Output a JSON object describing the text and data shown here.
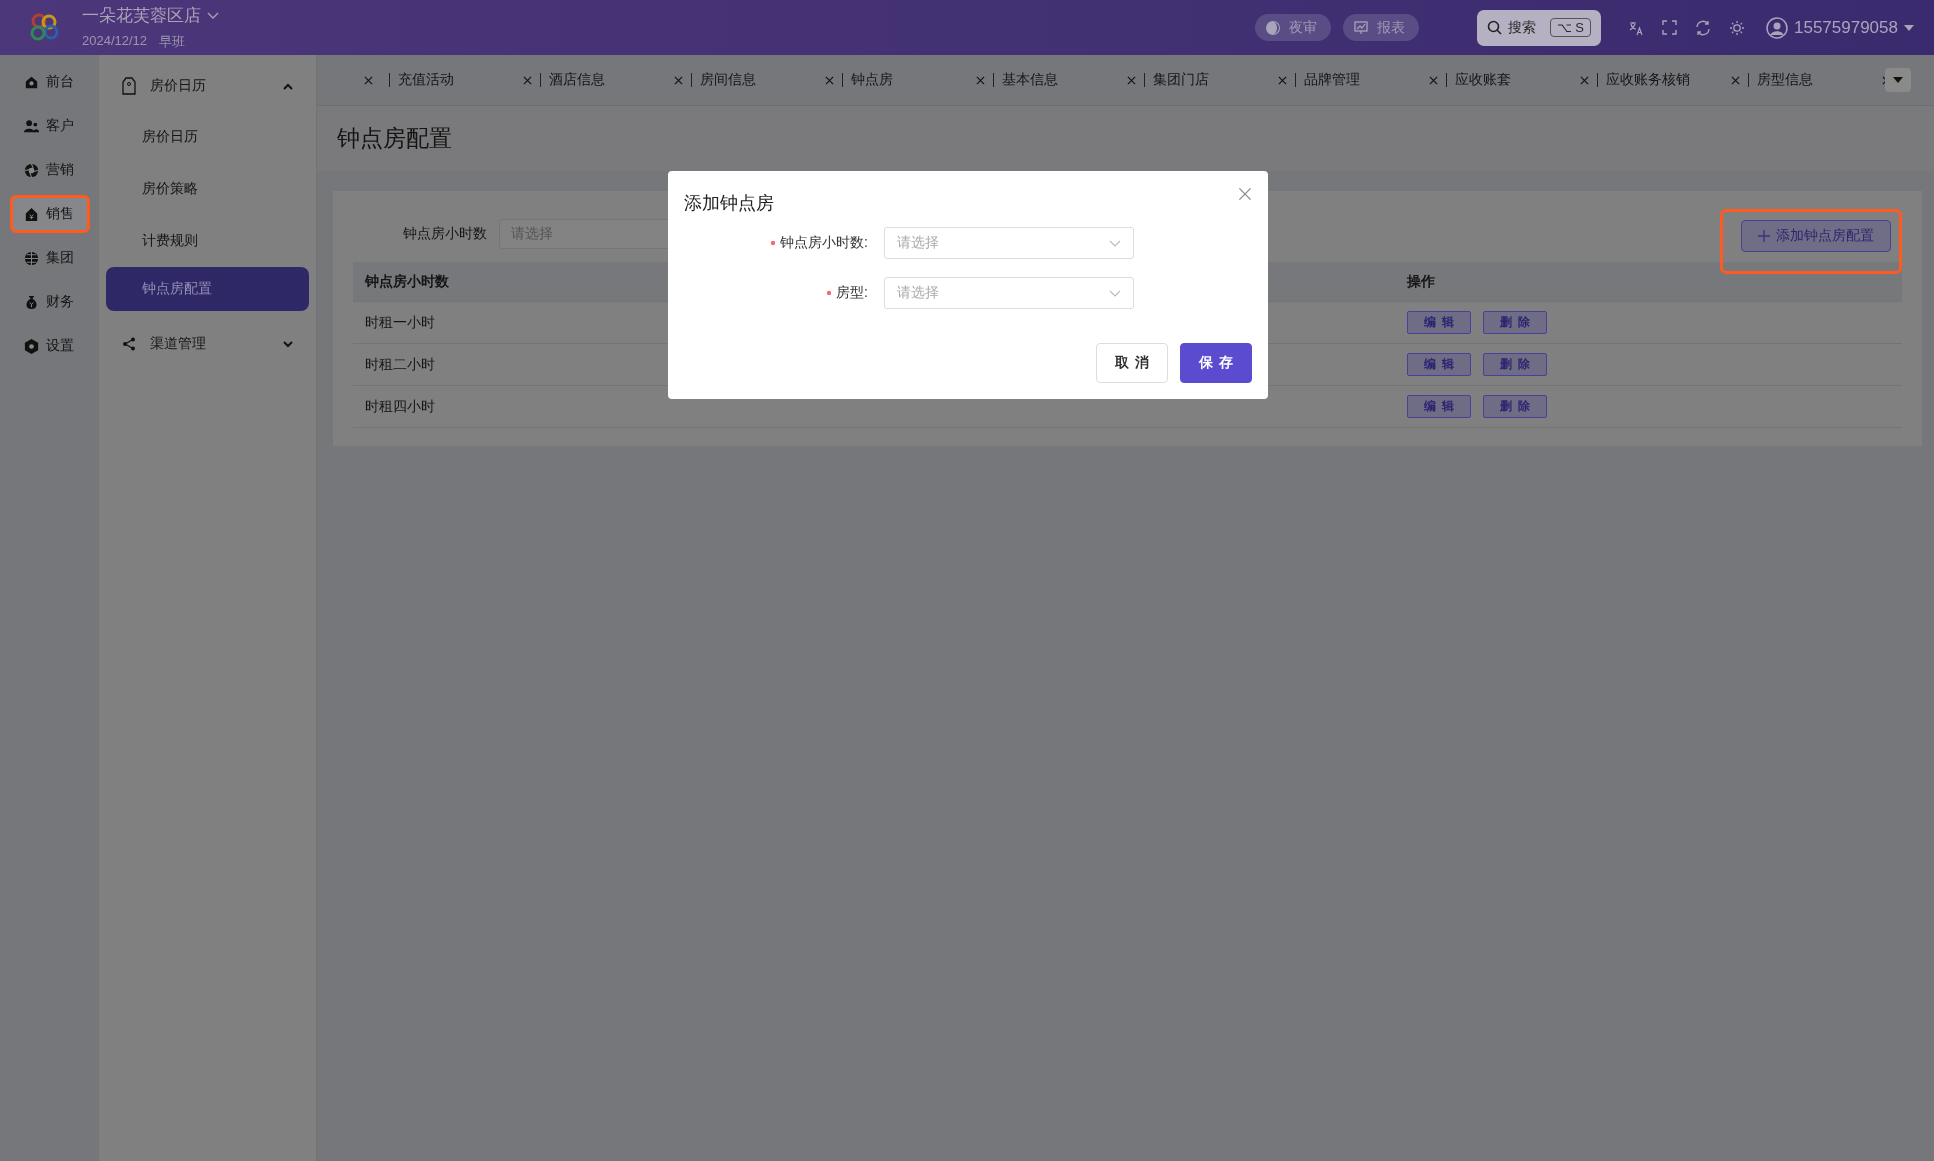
{
  "header": {
    "store": "一朵花芙蓉区店",
    "date": "2024/12/12",
    "shift": "早班",
    "buttons": [
      {
        "label": "夜审",
        "kind": "moon"
      },
      {
        "label": "报表",
        "kind": "chart"
      }
    ],
    "search": {
      "label": "搜索",
      "shortcut": "⌥ S"
    },
    "user": "15575979058"
  },
  "nav": [
    {
      "label": "前台",
      "selected": false,
      "highlighted": false
    },
    {
      "label": "客户",
      "selected": false,
      "highlighted": false
    },
    {
      "label": "营销",
      "selected": false,
      "highlighted": false
    },
    {
      "label": "销售",
      "selected": true,
      "highlighted": true
    },
    {
      "label": "集团",
      "selected": false,
      "highlighted": false
    },
    {
      "label": "财务",
      "selected": false,
      "highlighted": false
    },
    {
      "label": "设置",
      "selected": false,
      "highlighted": false
    }
  ],
  "subnav": [
    {
      "label": "房价日历",
      "expanded": true,
      "children": [
        {
          "label": "房价日历",
          "selected": false
        },
        {
          "label": "房价策略",
          "selected": false
        },
        {
          "label": "计费规则",
          "selected": false
        },
        {
          "label": "钟点房配置",
          "selected": true
        }
      ]
    },
    {
      "label": "渠道管理",
      "expanded": false
    }
  ],
  "tabs": [
    {
      "label": "充值活动"
    },
    {
      "label": "酒店信息"
    },
    {
      "label": "房间信息"
    },
    {
      "label": "钟点房"
    },
    {
      "label": "基本信息"
    },
    {
      "label": "集团门店"
    },
    {
      "label": "品牌管理"
    },
    {
      "label": "应收账套"
    },
    {
      "label": "应收账务核销"
    },
    {
      "label": "房型信息"
    }
  ],
  "page": {
    "title": "钟点房配置",
    "filter": {
      "label": "钟点房小时数",
      "placeholder": "请选择"
    },
    "add_button": {
      "label": "添加钟点房配置",
      "highlighted": true
    },
    "table": {
      "columns": {
        "column_1": "钟点房小时数",
        "column_3": "操作"
      },
      "rows": [
        {
          "column_1": "时租一小时",
          "actions": [
            "编辑",
            "删除"
          ]
        },
        {
          "column_1": "时租二小时",
          "actions": [
            "编辑",
            "删除"
          ]
        },
        {
          "column_1": "时租四小时",
          "actions": [
            "编辑",
            "删除"
          ]
        }
      ]
    }
  },
  "modal": {
    "title": "添加钟点房",
    "fields": [
      {
        "label": "钟点房小时数:",
        "required": true,
        "placeholder": "请选择"
      },
      {
        "label": "房型:",
        "required": true,
        "placeholder": "请选择"
      }
    ],
    "buttons": [
      {
        "label": "取消",
        "kind": "default"
      },
      {
        "label": "保存",
        "kind": "primary"
      }
    ]
  }
}
